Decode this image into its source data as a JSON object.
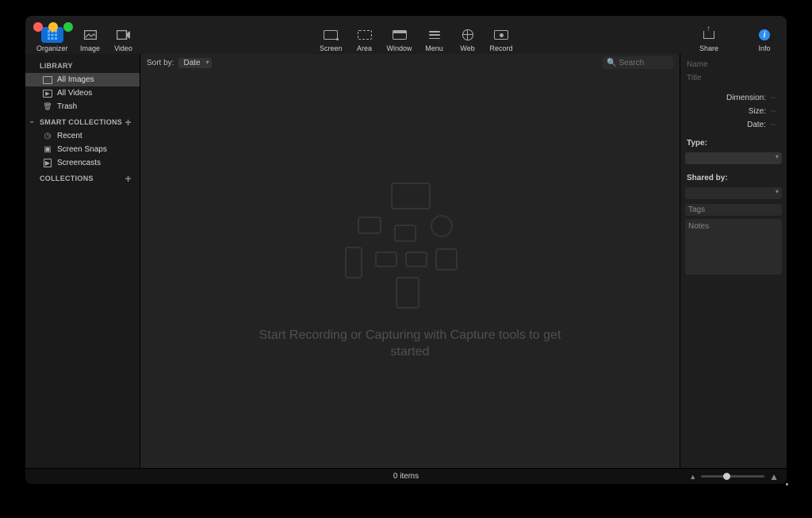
{
  "toolbar": {
    "left": [
      {
        "label": "Organizer",
        "active": true
      },
      {
        "label": "Image"
      },
      {
        "label": "Video"
      }
    ],
    "capture": [
      {
        "label": "Screen"
      },
      {
        "label": "Area"
      },
      {
        "label": "Window"
      },
      {
        "label": "Menu"
      },
      {
        "label": "Web"
      },
      {
        "label": "Record"
      }
    ],
    "right": [
      {
        "label": "Share"
      },
      {
        "label": "Info",
        "active": true
      }
    ]
  },
  "sidebar": {
    "library_header": "LIBRARY",
    "library": [
      {
        "label": "All Images",
        "active": true,
        "icon": "img"
      },
      {
        "label": "All Videos",
        "icon": "vid"
      },
      {
        "label": "Trash",
        "icon": "trash"
      }
    ],
    "smart_header": "SMART COLLECTIONS",
    "smart": [
      {
        "label": "Recent",
        "icon": "clock"
      },
      {
        "label": "Screen Snaps",
        "icon": "snap"
      },
      {
        "label": "Screencasts",
        "icon": "cast"
      }
    ],
    "collections_header": "COLLECTIONS"
  },
  "sortbar": {
    "label": "Sort by:",
    "value": "Date",
    "search_placeholder": "Search"
  },
  "empty_message": "Start Recording or Capturing with Capture tools to get started",
  "info": {
    "name_label": "Name",
    "title_label": "Title",
    "dimension_label": "Dimension:",
    "dimension_value": "--",
    "size_label": "Size:",
    "size_value": "--",
    "date_label": "Date:",
    "date_value": "--",
    "type_label": "Type:",
    "shared_label": "Shared by:",
    "tags_label": "Tags",
    "notes_label": "Notes"
  },
  "status": {
    "count": "0 items"
  }
}
